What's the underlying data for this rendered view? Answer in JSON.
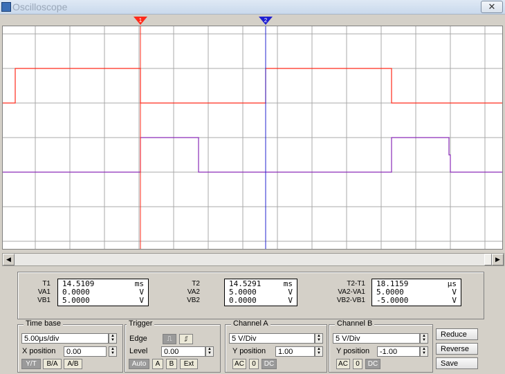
{
  "window": {
    "title": "Oscilloscope",
    "close_glyph": "✕"
  },
  "colors": {
    "channel_a": "#ff2a1a",
    "channel_b": "#8a2bb8",
    "cursor_1": "#ff2a1a",
    "cursor_2": "#2020d0",
    "grid": "#a8a8a8"
  },
  "cursors": [
    {
      "label": "1"
    },
    {
      "label": "2"
    }
  ],
  "measurements": {
    "t1": {
      "label": "T1",
      "value": "14.5109",
      "unit": "ms"
    },
    "va1": {
      "label": "VA1",
      "value": "0.0000",
      "unit": "V"
    },
    "vb1": {
      "label": "VB1",
      "value": "5.0000",
      "unit": "V"
    },
    "t2": {
      "label": "T2",
      "value": "14.5291",
      "unit": "ms"
    },
    "va2": {
      "label": "VA2",
      "value": "5.0000",
      "unit": "V"
    },
    "vb2": {
      "label": "VB2",
      "value": "0.0000",
      "unit": "V"
    },
    "dt": {
      "label": "T2-T1",
      "value": "18.1159",
      "unit": "μs"
    },
    "dva": {
      "label": "VA2-VA1",
      "value": "5.0000",
      "unit": "V"
    },
    "dvb": {
      "label": "VB2-VB1",
      "value": "-5.0000",
      "unit": "V"
    }
  },
  "timebase": {
    "title": "Time base",
    "scale": "5.00μs/div",
    "xpos_label": "X position",
    "xpos": "0.00",
    "modes": [
      "Y/T",
      "B/A",
      "A/B"
    ]
  },
  "trigger": {
    "title": "Trigger",
    "edge_label": "Edge",
    "edge_rise_icon": "rising-edge",
    "edge_fall_icon": "falling-edge",
    "level_label": "Level",
    "level": "0.00",
    "sources": [
      "Auto",
      "A",
      "B",
      "Ext"
    ]
  },
  "channel_a": {
    "title": "Channel A",
    "scale": "5 V/Div",
    "ypos_label": "Y position",
    "ypos": "1.00",
    "couplings": [
      "AC",
      "0",
      "DC"
    ]
  },
  "channel_b": {
    "title": "Channel B",
    "scale": "5 V/Div",
    "ypos_label": "Y position",
    "ypos": "-1.00",
    "couplings": [
      "AC",
      "0",
      "DC"
    ]
  },
  "actions": {
    "reduce": "Reduce",
    "reverse": "Reverse",
    "save": "Save"
  }
}
